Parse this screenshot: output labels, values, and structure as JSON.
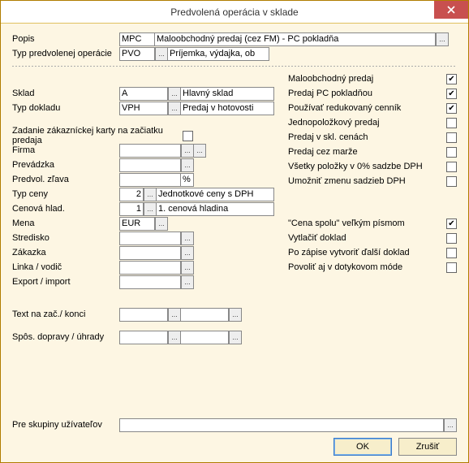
{
  "window": {
    "title": "Predvolená operácia v sklade"
  },
  "labels": {
    "popis": "Popis",
    "typ_predvolenej": "Typ predvolenej operácie",
    "sklad": "Sklad",
    "typ_dokladu": "Typ dokladu",
    "zadanie_karty": "Zadanie zákazníckej karty na začiatku predaja",
    "firma": "Firma",
    "prevadzka": "Prevádzka",
    "predvol_zlava": "Predvol. zľava",
    "typ_ceny": "Typ ceny",
    "cenova_hlad": "Cenová hlad.",
    "mena": "Mena",
    "stredisko": "Stredisko",
    "zakazka": "Zákazka",
    "linka": "Linka / vodič",
    "export": "Export / import",
    "text_zac": "Text na zač./ konci",
    "spos_dopravy": "Spôs. dopravy / úhrady",
    "pre_skupiny": "Pre skupiny užívateľov"
  },
  "values": {
    "popis_code": "MPC",
    "popis_desc": "Maloobchodný predaj (cez FM) - PC pokladňa",
    "typ_predvolenej_code": "PVO",
    "typ_predvolenej_desc": "Príjemka, výdajka, ob",
    "sklad_code": "A",
    "sklad_desc": "Hlavný sklad",
    "typ_dokladu_code": "VPH",
    "typ_dokladu_desc": "Predaj v hotovosti",
    "firma": "",
    "prevadzka": "",
    "predvol_zlava": "",
    "predvol_zlava_unit": "%",
    "typ_ceny_code": "2",
    "typ_ceny_desc": "Jednotkové ceny s DPH",
    "cenova_hlad_code": "1",
    "cenova_hlad_desc": "1. cenová hladina",
    "mena": "EUR",
    "stredisko": "",
    "zakazka": "",
    "linka": "",
    "export": "",
    "text_zac_a": "",
    "text_zac_b": "",
    "spos_a": "",
    "spos_b": "",
    "pre_skupiny": ""
  },
  "checks": {
    "maloobchodny": {
      "label": "Maloobchodný predaj",
      "checked": true
    },
    "predaj_pc": {
      "label": "Predaj PC pokladňou",
      "checked": true
    },
    "pouzivat_redukovany": {
      "label": "Používať redukovaný cenník",
      "checked": true
    },
    "jednopolozkovy": {
      "label": "Jednopoložkový predaj",
      "checked": false
    },
    "predaj_skl": {
      "label": "Predaj v skl. cenách",
      "checked": false
    },
    "predaj_marze": {
      "label": "Predaj cez marže",
      "checked": false
    },
    "vsetky_0dph": {
      "label": "Všetky položky v 0% sadzbe DPH",
      "checked": false
    },
    "umoznit_zmenu": {
      "label": "Umožniť zmenu sadzieb DPH",
      "checked": false
    },
    "cena_spolu": {
      "label": "\"Cena spolu\" veľkým písmom",
      "checked": true
    },
    "vytlacit": {
      "label": "Vytlačiť doklad",
      "checked": false
    },
    "po_zapise": {
      "label": "Po zápise vytvoriť ďalší doklad",
      "checked": false
    },
    "povolit_dotyk": {
      "label": "Povoliť aj v dotykovom móde",
      "checked": false
    },
    "zadanie_karty": {
      "checked": false
    }
  },
  "buttons": {
    "ok": "OK",
    "cancel": "Zrušiť",
    "dots": "..."
  }
}
